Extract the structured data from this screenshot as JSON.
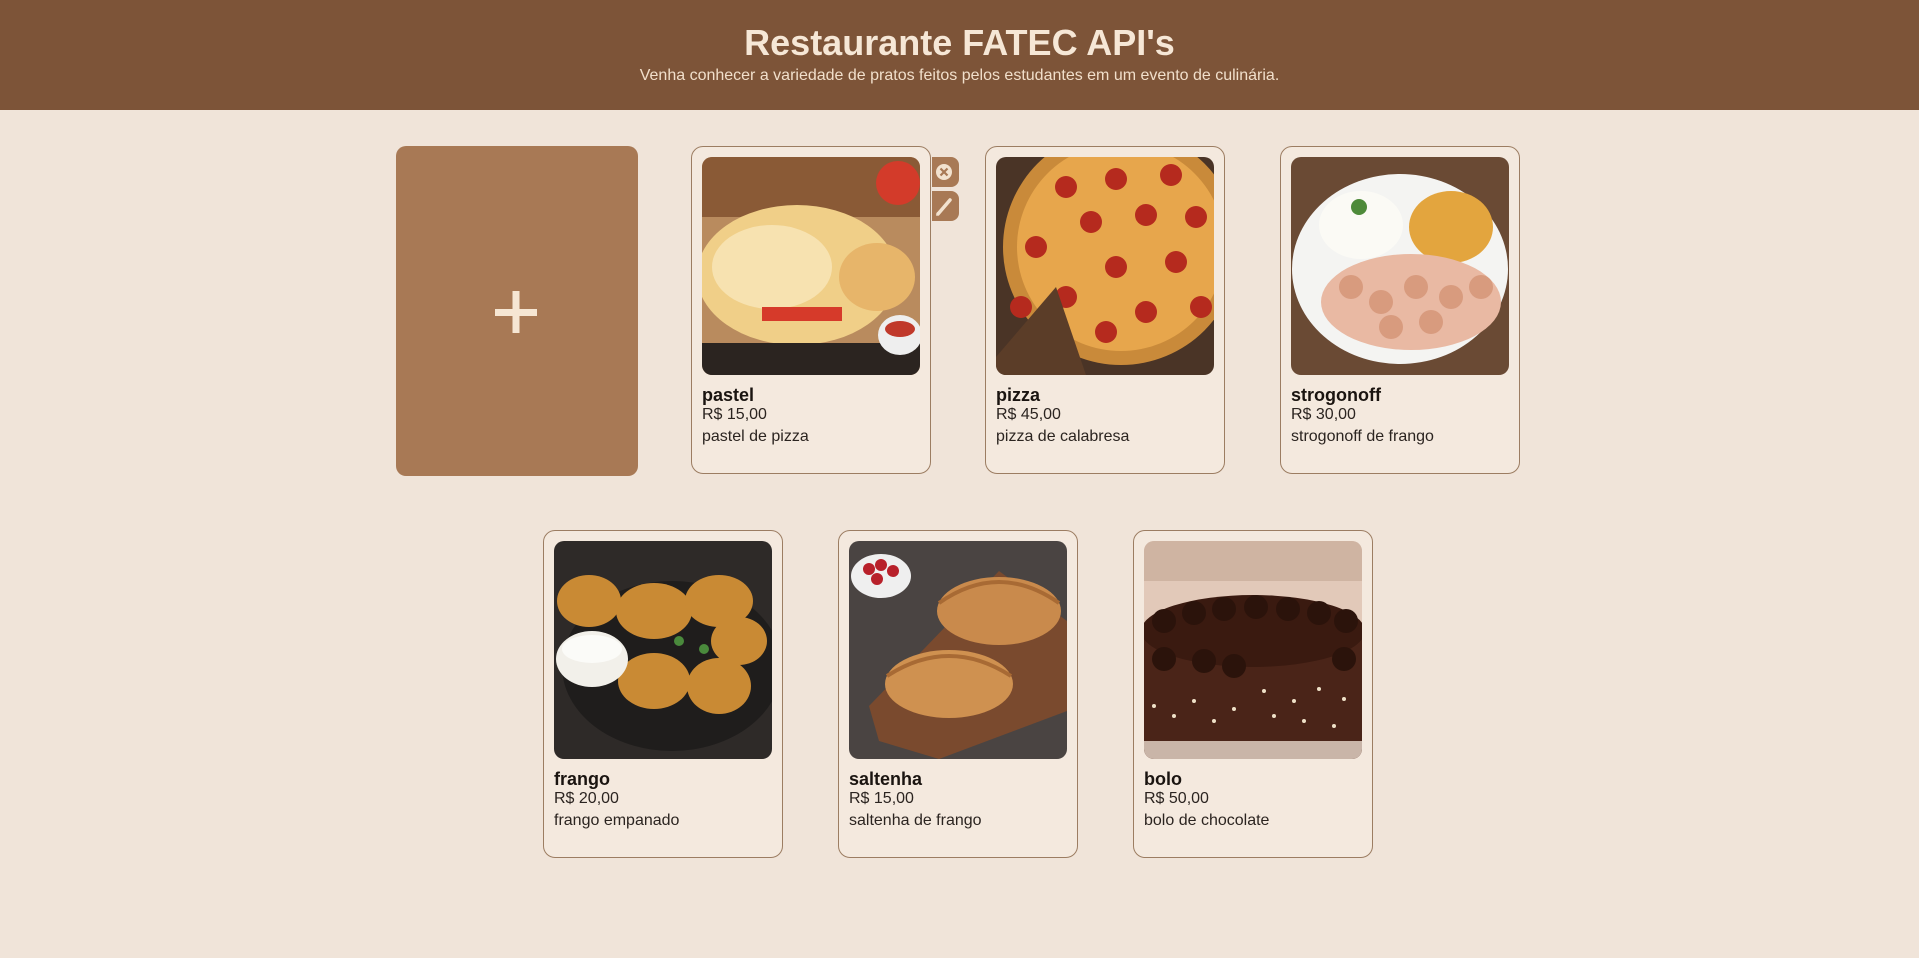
{
  "header": {
    "title": "Restaurante FATEC API's",
    "subtitle": "Venha conhecer a variedade de pratos feitos pelos estudantes em um evento de culinária."
  },
  "add_card": {
    "icon": "plus-icon"
  },
  "edit_controls": {
    "delete_icon": "close-circle-icon",
    "edit_icon": "pencil-icon"
  },
  "dishes": [
    {
      "name": "pastel",
      "price": "R$ 15,00",
      "description": "pastel de pizza",
      "image": "pastel-image"
    },
    {
      "name": "pizza",
      "price": "R$ 45,00",
      "description": "pizza de calabresa",
      "image": "pizza-image"
    },
    {
      "name": "strogonoff",
      "price": "R$ 30,00",
      "description": "strogonoff de frango",
      "image": "strogonoff-image"
    },
    {
      "name": "frango",
      "price": "R$ 20,00",
      "description": "frango empanado",
      "image": "frango-image"
    },
    {
      "name": "saltenha",
      "price": "R$ 15,00",
      "description": "saltenha de frango",
      "image": "saltenha-image"
    },
    {
      "name": "bolo",
      "price": "R$ 50,00",
      "description": "bolo de chocolate",
      "image": "bolo-image"
    }
  ],
  "colors": {
    "header_bg": "#7d5438",
    "page_bg": "#f0e4d9",
    "card_bg": "#f4e9de",
    "accent": "#a87955"
  }
}
